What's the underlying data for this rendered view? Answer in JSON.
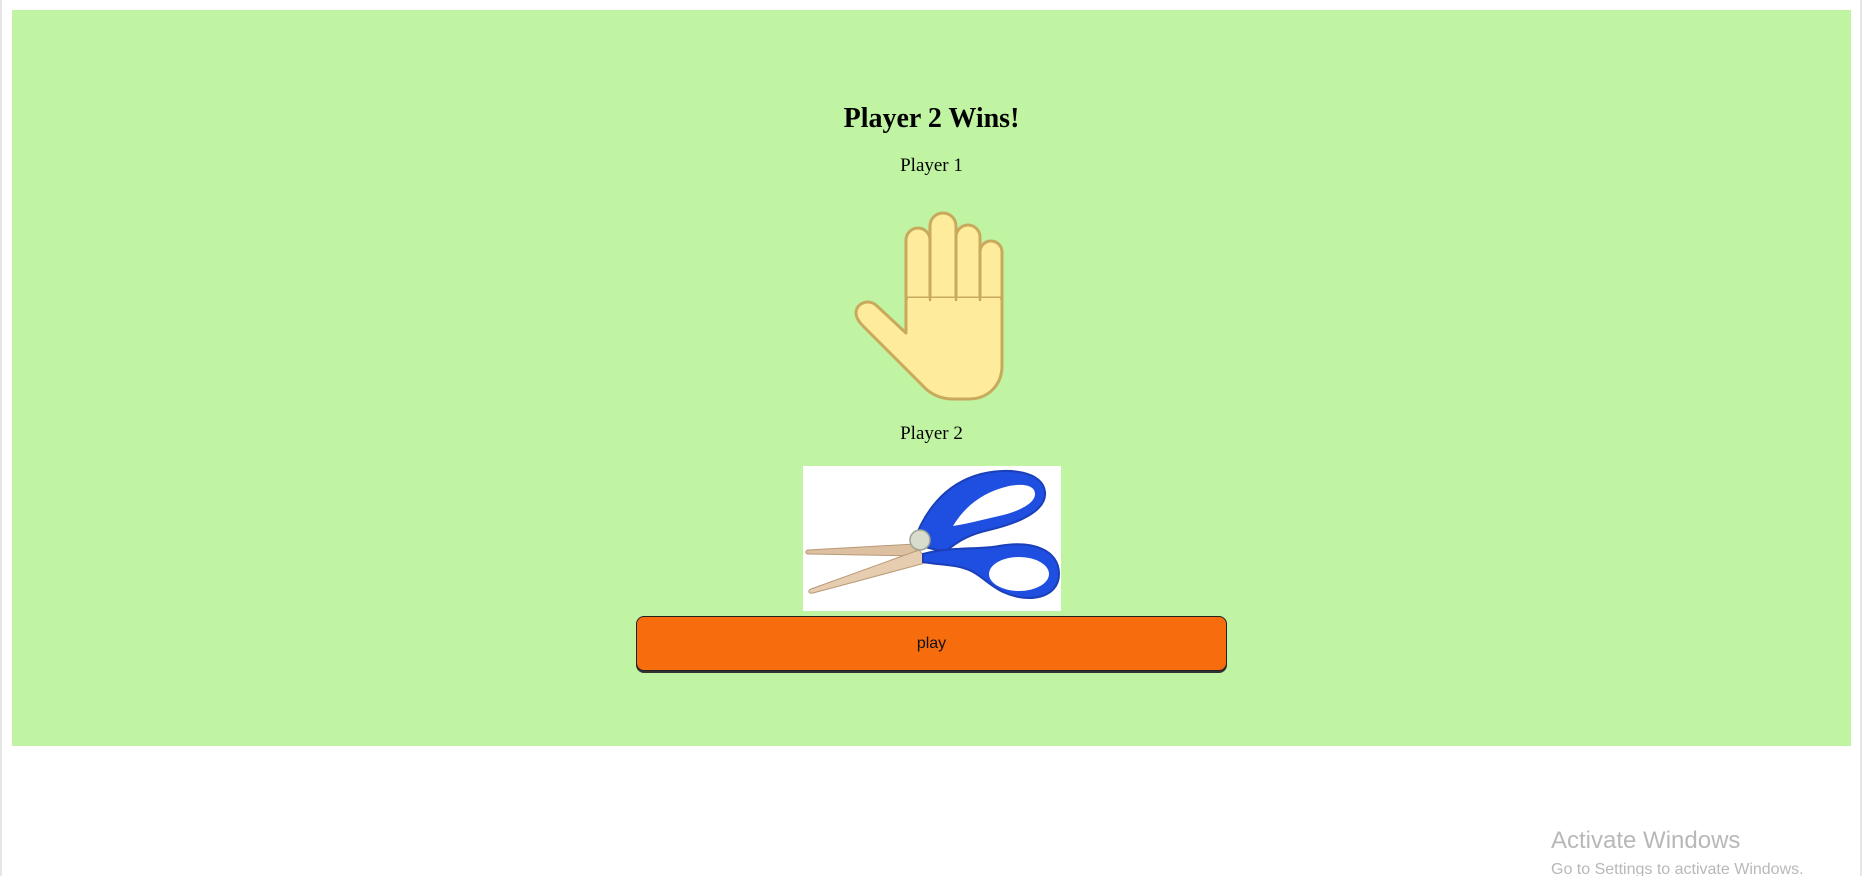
{
  "game": {
    "result": "Player 2 Wins!",
    "player1": {
      "label": "Player 1",
      "choice_icon": "paper-hand-icon"
    },
    "player2": {
      "label": "Player 2",
      "choice_icon": "scissors-icon"
    },
    "play_label": "play"
  },
  "colors": {
    "panel_background": "#c0f4a3",
    "play_button": "#f76c0c",
    "hand_fill": "#feeb9c",
    "hand_outline": "#c9a95c",
    "scissors_handle": "#1f4fe0",
    "scissors_blade": "#dcc0a0"
  },
  "os_watermark": {
    "title": "Activate Windows",
    "subtitle": "Go to Settings to activate Windows."
  }
}
